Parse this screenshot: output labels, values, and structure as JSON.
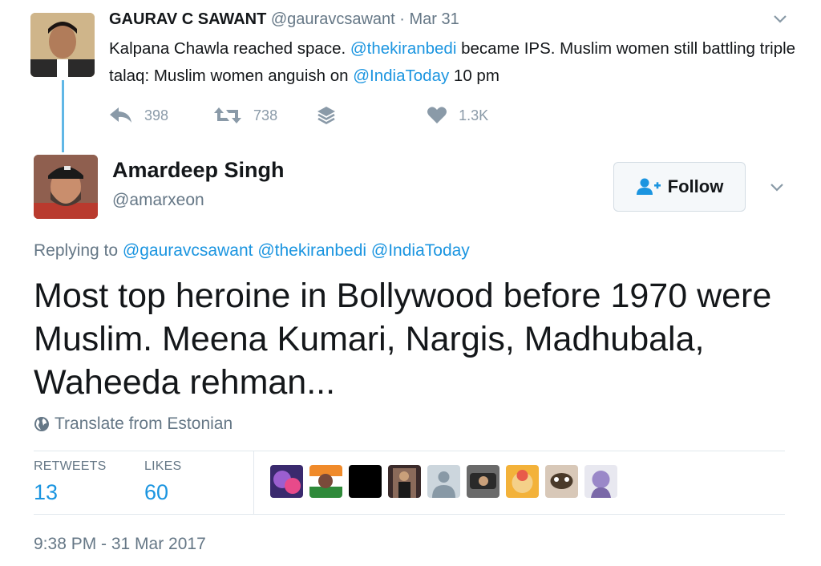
{
  "parent_tweet": {
    "name": "GAURAV C SAWANT",
    "handle": "@gauravcsawant",
    "separator": "·",
    "date": "Mar 31",
    "text": {
      "part1": "Kalpana Chawla reached space. ",
      "mention1": "@thekiranbedi",
      "part2": " became IPS. Muslim women still battling triple talaq: Muslim women anguish on ",
      "mention2": "@IndiaToday",
      "part3": " 10 pm"
    },
    "actions": {
      "reply_count": "398",
      "retweet_count": "738",
      "like_count": "1.3K"
    },
    "icons": [
      "reply-icon",
      "retweet-icon",
      "stack-icon",
      "heart-icon",
      "chevron-down-icon"
    ]
  },
  "main_tweet": {
    "name": "Amardeep Singh",
    "handle": "@amarxeon",
    "follow_label": "Follow",
    "replying_prefix": "Replying to",
    "replying_mentions": [
      "@gauravcsawant",
      "@thekiranbedi",
      "@IndiaToday"
    ],
    "text": "Most top heroine in Bollywood before 1970 were Muslim. Meena Kumari, Nargis, Madhubala, Waheeda rehman...",
    "translate_label": "Translate from Estonian",
    "stats": {
      "retweets_label": "RETWEETS",
      "retweets_value": "13",
      "likes_label": "LIKES",
      "likes_value": "60"
    },
    "timestamp": "9:38 PM - 31 Mar 2017"
  },
  "colors": {
    "link": "#1b95e0",
    "thread_line": "#60b7e6",
    "secondary_text": "#657786",
    "action_icon": "#8a9aa8",
    "divider": "#e1e8ed"
  }
}
